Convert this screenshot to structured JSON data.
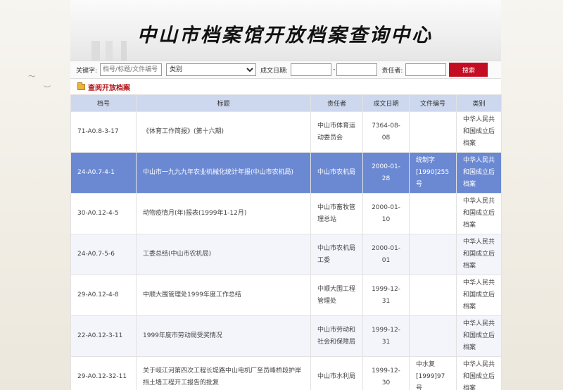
{
  "header": {
    "title": "中山市档案馆开放档案查询中心"
  },
  "search": {
    "keyword_label": "关键字:",
    "keyword_placeholder": "档号/标题/文件编号",
    "category_value": "类别",
    "date_label": "成文日期:",
    "date_sep": "-",
    "responsible_label": "责任者:",
    "button_label": "搜索"
  },
  "section": {
    "title": "查阅开放档案"
  },
  "table": {
    "columns": [
      "档号",
      "标题",
      "责任者",
      "成文日期",
      "文件编号",
      "类别"
    ],
    "rows": [
      {
        "id": "71-A0.8-3-17",
        "title": "《体育工作简报》(第十六期)",
        "responsible": "中山市体育运动委员会",
        "date": "7364-08-08",
        "doc_no": "",
        "category": "中华人民共和国成立后档案"
      },
      {
        "id": "24-A0.7-4-1",
        "title": "中山市一九九九年农业机械化统计年报(中山市农机局)",
        "responsible": "中山市农机局",
        "date": "2000-01-28",
        "doc_no": "统制字[1990]255号",
        "category": "中华人民共和国成立后档案"
      },
      {
        "id": "30-A0.12-4-5",
        "title": "动物疫情月(年)报表(1999年1-12月)",
        "responsible": "中山市畜牧管理总站",
        "date": "2000-01-10",
        "doc_no": "",
        "category": "中华人民共和国成立后档案"
      },
      {
        "id": "24-A0.7-5-6",
        "title": "工委总结(中山市农机局)",
        "responsible": "中山市农机局工委",
        "date": "2000-01-01",
        "doc_no": "",
        "category": "中华人民共和国成立后档案"
      },
      {
        "id": "29-A0.12-4-8",
        "title": "中顺大围管理处1999年度工作总结",
        "responsible": "中顺大围工程管理处",
        "date": "1999-12-31",
        "doc_no": "",
        "category": "中华人民共和国成立后档案"
      },
      {
        "id": "22-A0.12-3-11",
        "title": "1999年度市劳动局受奖情况",
        "responsible": "中山市劳动和社会和保障局",
        "date": "1999-12-31",
        "doc_no": "",
        "category": "中华人民共和国成立后档案"
      },
      {
        "id": "29-A0.12-32-11",
        "title": "关于岐江河第四次工程长堤路中山电机厂至员峰桥段护岸挡土墙工程开工报告的批复",
        "responsible": "中山市水利局",
        "date": "1999-12-30",
        "doc_no": "中水复[1999]97号",
        "category": "中华人民共和国成立后档案"
      }
    ]
  }
}
